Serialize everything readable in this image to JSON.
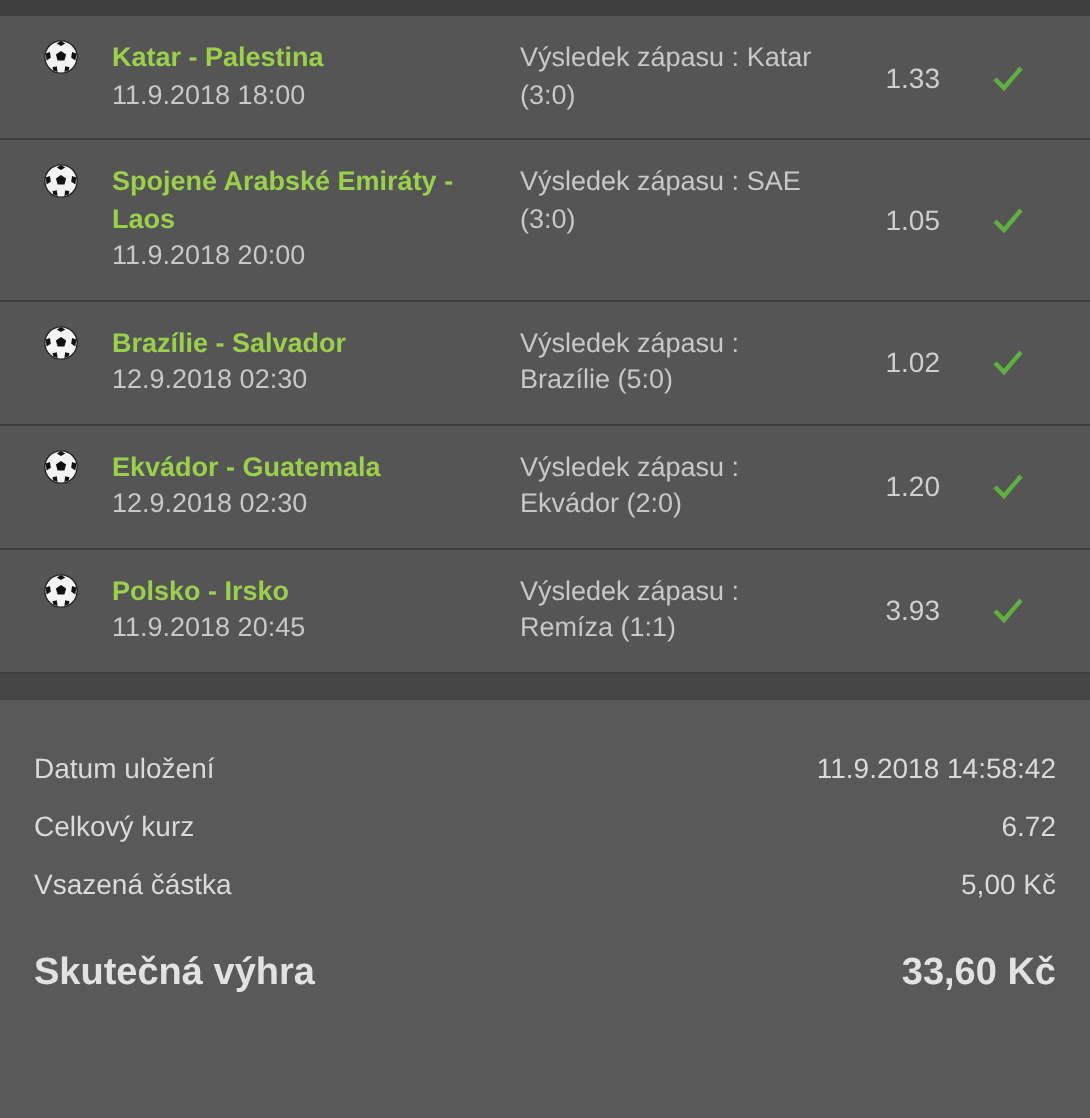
{
  "bets": [
    {
      "match": "Katar - Palestina",
      "datetime": "11.9.2018 18:00",
      "pick": "Výsledek zápasu : Katar (3:0)",
      "odds": "1.33",
      "won": true
    },
    {
      "match": "Spojené Arabské Emiráty - Laos",
      "datetime": "11.9.2018 20:00",
      "pick": "Výsledek zápasu : SAE (3:0)",
      "odds": "1.05",
      "won": true
    },
    {
      "match": "Brazílie - Salvador",
      "datetime": "12.9.2018 02:30",
      "pick": "Výsledek zápasu : Brazílie (5:0)",
      "odds": "1.02",
      "won": true
    },
    {
      "match": "Ekvádor - Guatemala",
      "datetime": "12.9.2018 02:30",
      "pick": "Výsledek zápasu : Ekvádor (2:0)",
      "odds": "1.20",
      "won": true
    },
    {
      "match": "Polsko - Irsko",
      "datetime": "11.9.2018 20:45",
      "pick": "Výsledek zápasu : Remíza (1:1)",
      "odds": "3.93",
      "won": true
    }
  ],
  "summary": [
    {
      "label": "Datum uložení",
      "value": "11.9.2018 14:58:42"
    },
    {
      "label": "Celkový kurz",
      "value": "6.72"
    },
    {
      "label": "Vsazená částka",
      "value": "5,00 Kč"
    }
  ],
  "total": {
    "label": "Skutečná výhra",
    "value": "33,60 Kč"
  }
}
